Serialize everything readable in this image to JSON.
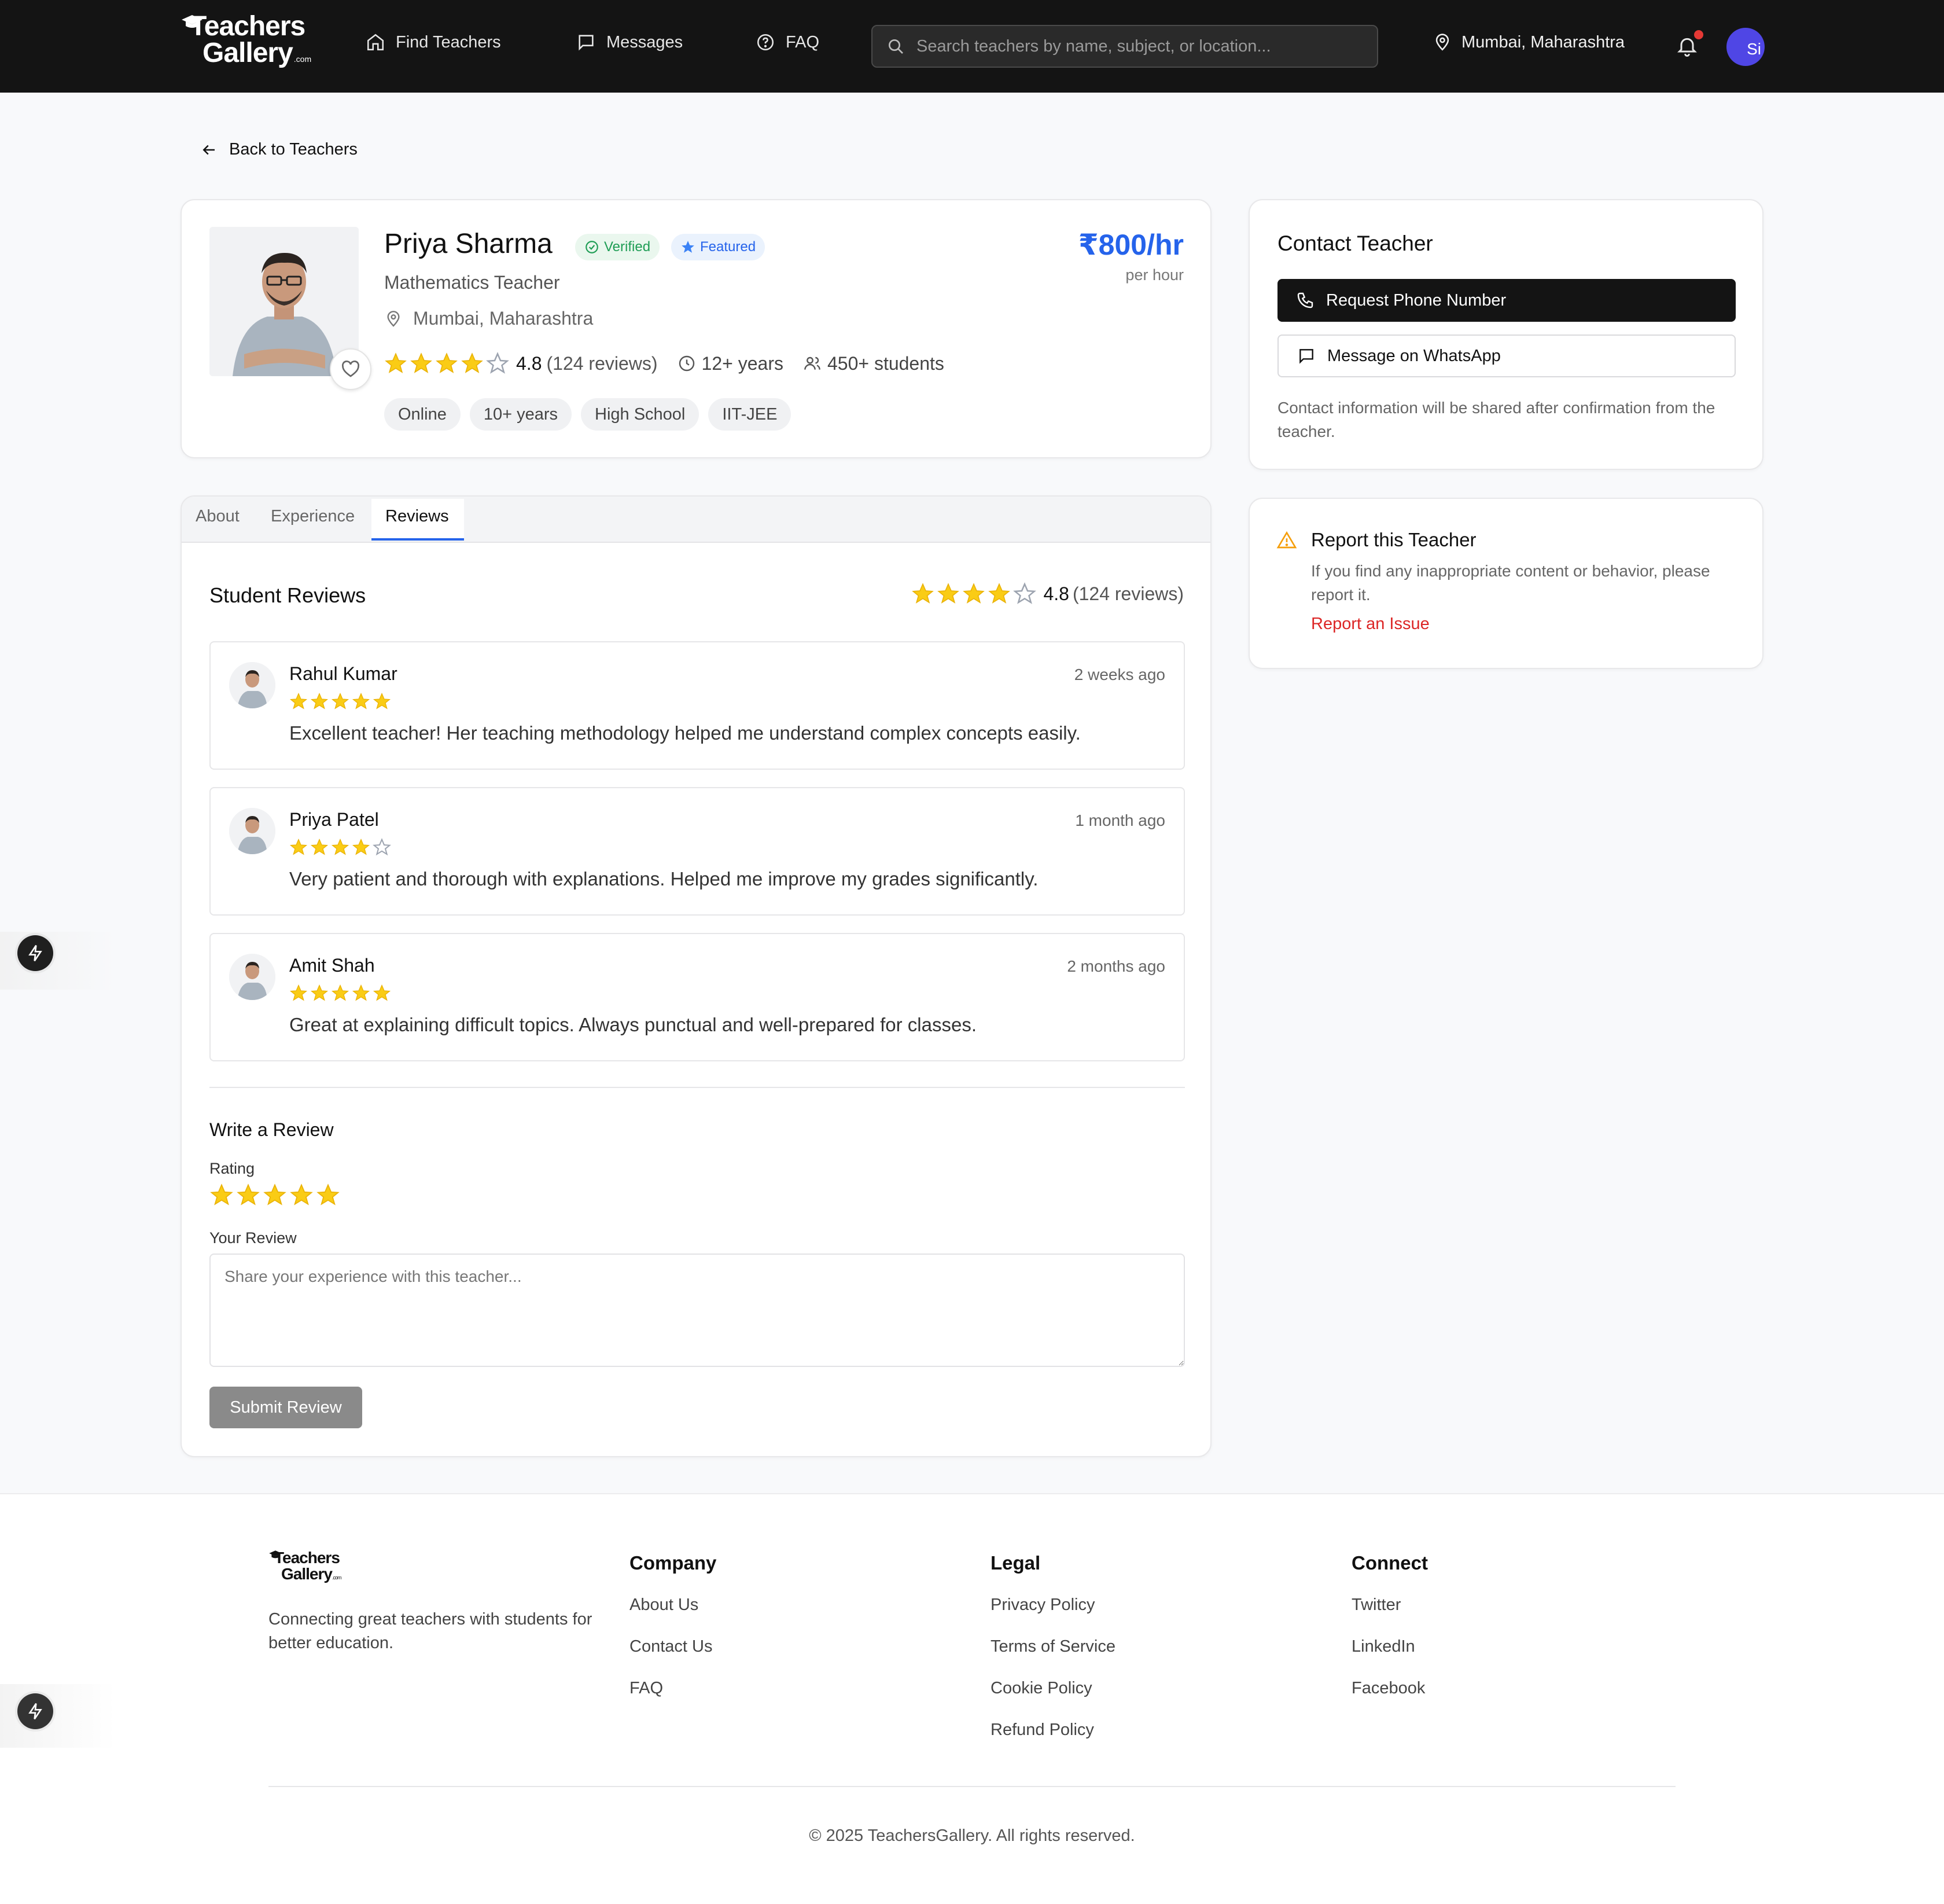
{
  "brand": {
    "line1": "Teachers",
    "line2": "Gallery",
    "suffix": ".com"
  },
  "nav": {
    "find_teachers": "Find Teachers",
    "messages": "Messages",
    "faq": "FAQ",
    "search_placeholder": "Search teachers by name, subject, or location...",
    "location": "Mumbai, Maharashtra",
    "avatar_initials": "Si"
  },
  "back_label": "Back to Teachers",
  "profile": {
    "name": "Priya Sharma",
    "verified": "Verified",
    "featured": "Featured",
    "subject": "Mathematics Teacher",
    "location": "Mumbai, Maharashtra",
    "rating": "4.8",
    "rating_stars": 4,
    "reviews": "(124 reviews)",
    "experience": "12+ years",
    "students": "450+ students",
    "tags": [
      "Online",
      "10+ years",
      "High School",
      "IIT-JEE"
    ],
    "price": "₹800/hr",
    "price_unit": "per hour"
  },
  "tabs": [
    "About",
    "Experience",
    "Reviews"
  ],
  "active_tab": "Reviews",
  "reviews_section": {
    "title": "Student Reviews",
    "rating": "4.8",
    "count": "(124 reviews)",
    "items": [
      {
        "name": "Rahul Kumar",
        "date": "2 weeks ago",
        "stars": 5,
        "text": "Excellent teacher! Her teaching methodology helped me understand complex concepts easily."
      },
      {
        "name": "Priya Patel",
        "date": "1 month ago",
        "stars": 4,
        "text": "Very patient and thorough with explanations. Helped me improve my grades significantly."
      },
      {
        "name": "Amit Shah",
        "date": "2 months ago",
        "stars": 5,
        "text": "Great at explaining difficult topics. Always punctual and well-prepared for classes."
      }
    ]
  },
  "write_review": {
    "title": "Write a Review",
    "rating_label": "Rating",
    "rating_stars": 5,
    "review_label": "Your Review",
    "placeholder": "Share your experience with this teacher...",
    "submit": "Submit Review"
  },
  "contact": {
    "title": "Contact Teacher",
    "phone_btn": "Request Phone Number",
    "whatsapp_btn": "Message on WhatsApp",
    "note": "Contact information will be shared after confirmation from the teacher."
  },
  "report": {
    "title": "Report this Teacher",
    "desc": "If you find any inappropriate content or behavior, please report it.",
    "link": "Report an Issue"
  },
  "footer": {
    "tagline": "Connecting great teachers with students for better education.",
    "company": {
      "title": "Company",
      "links": [
        "About Us",
        "Contact Us",
        "FAQ"
      ]
    },
    "legal": {
      "title": "Legal",
      "links": [
        "Privacy Policy",
        "Terms of Service",
        "Cookie Policy",
        "Refund Policy"
      ]
    },
    "connect": {
      "title": "Connect",
      "links": [
        "Twitter",
        "LinkedIn",
        "Facebook"
      ]
    },
    "copyright": "© 2025 TeachersGallery. All rights reserved."
  },
  "colors": {
    "accent": "#2563eb",
    "star": "#facc15",
    "danger": "#dc2626",
    "nav_bg": "#141414",
    "verified": "#1f9d55"
  }
}
